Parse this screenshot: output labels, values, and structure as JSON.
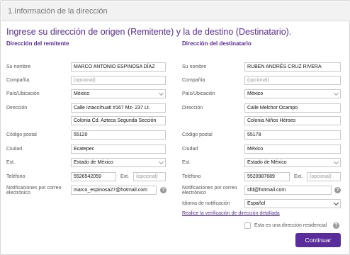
{
  "section": {
    "title": "1.Información de la dirección"
  },
  "headline": "Ingrese su dirección de origen (Remitente) y la de destino (Destinatario).",
  "sender": {
    "title": "Dirección del remitente",
    "name_label": "Su nombre",
    "name_value": "MARCO ANTONIO ESPINOSA DÍAZ",
    "company_label": "Compañía",
    "company_placeholder": "(opcional)",
    "country_label": "País/Ubicación",
    "country_value": "México",
    "address_label": "Dirección",
    "address1_value": "Calle Iztaccíhuatl #167 Mz- 237 Lt.",
    "address2_value": "Colonia Cd. Azteca Segunda Sección",
    "postal_label": "Código postal",
    "postal_value": "55120",
    "city_label": "Ciudad",
    "city_value": "Ecatepec",
    "state_label": "Est.",
    "state_value": "Estado de México",
    "phone_label": "Teléfono",
    "phone_value": "5526542059",
    "ext_label": "Ext.",
    "ext_placeholder": "(opcional)",
    "notif_label_1": "Notificaciones por correo",
    "notif_label_2": "electrónico",
    "email_value": "marco_espinosa27@hotmail.com"
  },
  "recipient": {
    "title": "Dirección del destinatario",
    "name_label": "Su nombre",
    "name_value": "RUBEN ANDRÉS CRUZ RIVERA",
    "company_label": "Compañía",
    "company_placeholder": "(opcional)",
    "country_label": "País/Ubicación",
    "country_value": "México",
    "address_label": "Dirección",
    "address1_value": "Calle Melchor Ocampo",
    "address2_value": "Colonia Niños Héroes",
    "postal_label": "Código postal",
    "postal_value": "55178",
    "city_label": "Ciudad",
    "city_value": "México",
    "state_label": "Est.",
    "state_value": "Estado de México",
    "phone_label": "Teléfono",
    "phone_value": "5520987689",
    "ext_label": "Ext.",
    "ext_placeholder": "(opcional)",
    "notif_label_1": "Notificaciones por correo",
    "notif_label_2": "electrónico",
    "email_value": "sfd@hotmail.com",
    "language_label": "Idioma de notificación",
    "language_value": "Español"
  },
  "verify_link": "Realice la verificación de dirección detallada",
  "residential_label": "Esta es una dirección residencial",
  "help_glyph": "?",
  "continue_button": "Continuar",
  "colors": {
    "accent": "#5a2d9c",
    "header_bg": "#f2f2f2"
  }
}
